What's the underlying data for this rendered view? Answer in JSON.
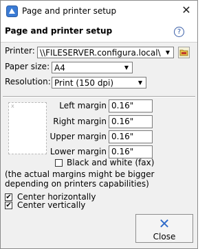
{
  "window": {
    "title": "Page and printer setup",
    "close_glyph": "✕"
  },
  "header": {
    "title": "Page and printer setup",
    "help_glyph": "?"
  },
  "printer": {
    "label": "Printer:",
    "value": "\\\\FILESERVER.configura.local\\"
  },
  "paper_size": {
    "label": "Paper size:",
    "value": "A4"
  },
  "resolution": {
    "label": "Resolution:",
    "value": "Print (150 dpi)"
  },
  "margins": {
    "left": {
      "label": "Left margin",
      "value": "0.16\""
    },
    "right": {
      "label": "Right margin",
      "value": "0.16\""
    },
    "upper": {
      "label": "Upper margin",
      "value": "0.16\""
    },
    "lower": {
      "label": "Lower margin",
      "value": "0.16\""
    }
  },
  "bw_fax": {
    "label": "Black and white (fax)",
    "checked": false
  },
  "note": {
    "line1": "(the actual margins might be bigger",
    "line2": "depending on printers capabilities)"
  },
  "center_h": {
    "label": "Center horizontally",
    "checked": true
  },
  "center_v": {
    "label": "Center vertically",
    "checked": true
  },
  "close_button": {
    "label": "Close"
  },
  "icons": {
    "dropdown": "chevron-down-icon",
    "folder": "folder-icon",
    "app": "app-icon",
    "preview": "page-preview-icon"
  },
  "colors": {
    "accent": "#2f6bc9"
  }
}
